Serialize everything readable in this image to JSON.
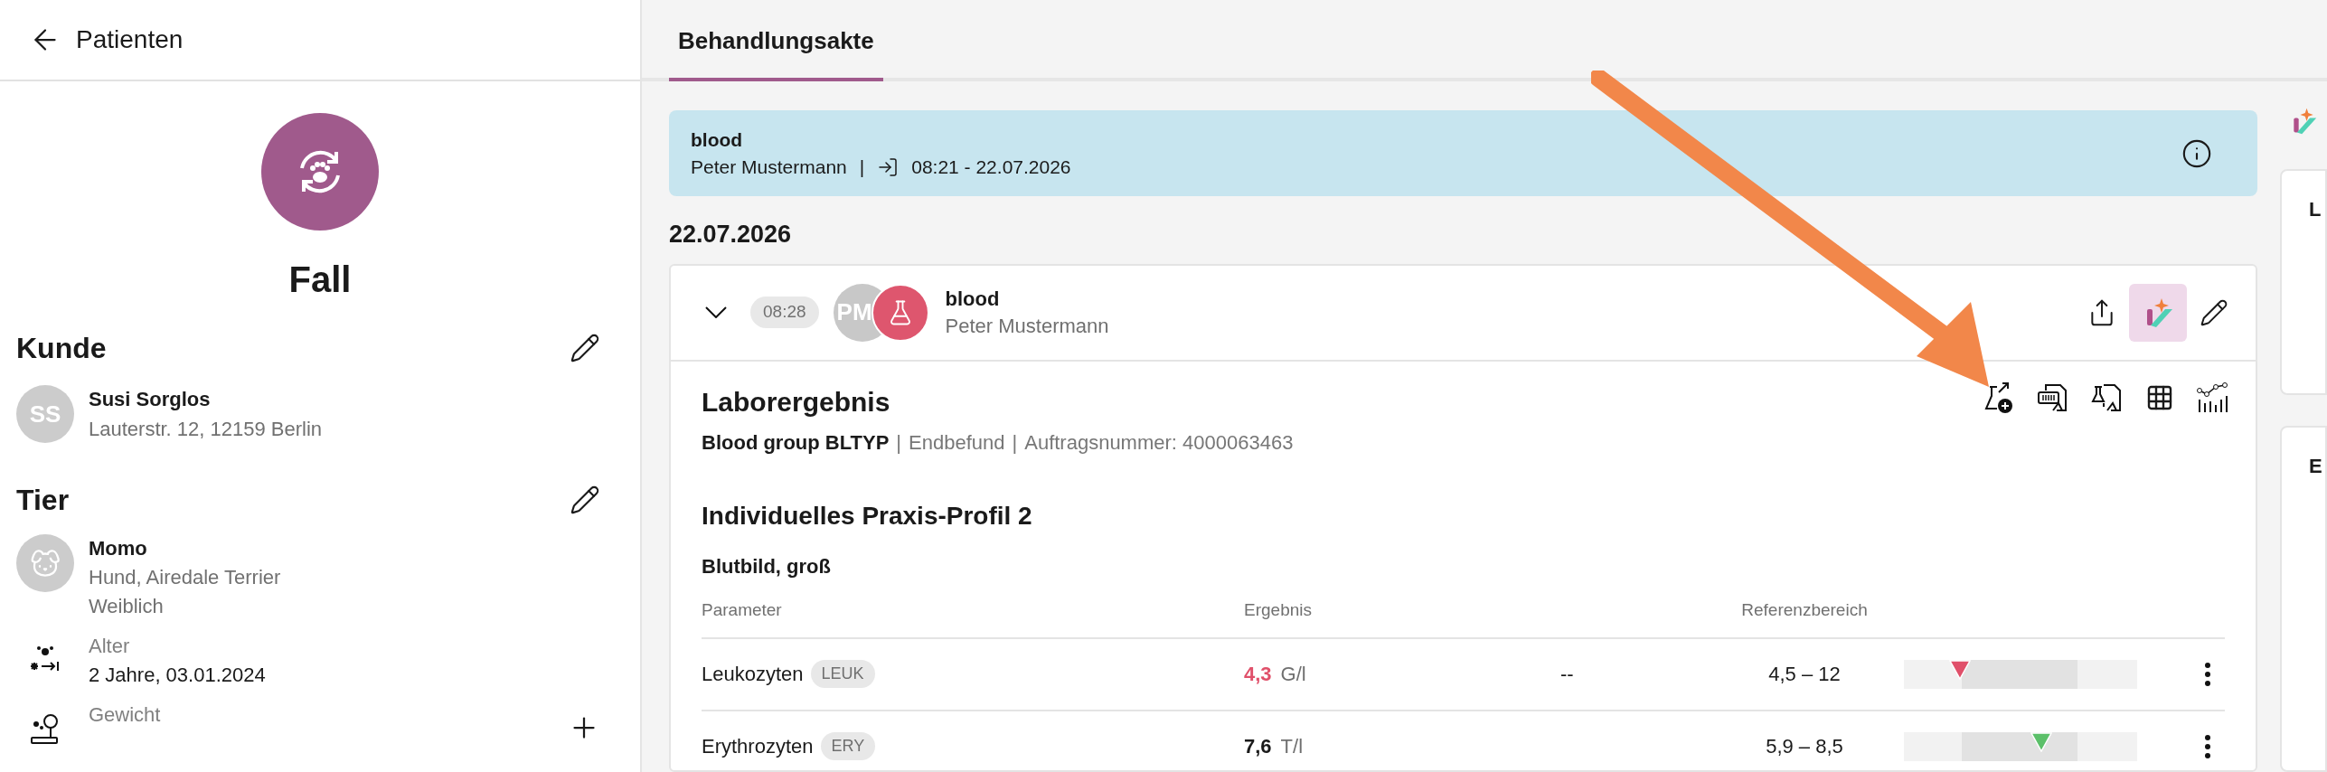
{
  "sidebar": {
    "back_label": "Patienten",
    "case_title": "Fall",
    "customer": {
      "heading": "Kunde",
      "initials": "SS",
      "name": "Susi Sorglos",
      "address": "Lauterstr. 12, 12159 Berlin"
    },
    "animal": {
      "heading": "Tier",
      "name": "Momo",
      "breed": "Hund, Airedale Terrier",
      "sex": "Weiblich"
    },
    "facts": [
      {
        "kind": "age",
        "label": "Alter",
        "value": "2 Jahre, 03.01.2024"
      },
      {
        "kind": "weight",
        "label": "Gewicht"
      }
    ]
  },
  "tabs": [
    {
      "label": "Behandlungsakte",
      "selected": true
    }
  ],
  "banner": {
    "title": "blood",
    "person": "Peter Mustermann",
    "separator": "|",
    "time": "08:21 - 22.07.2026"
  },
  "date_heading": "22.07.2026",
  "entry": {
    "expanded": true,
    "time": "08:28",
    "initials": "PM",
    "title": "blood",
    "person": "Peter Mustermann",
    "lab": {
      "title": "Laborergebnis",
      "test": "Blood group BLTYP",
      "status": "Endbefund",
      "order": "Auftragsnummer: 4000063463",
      "separator": "|",
      "profile": "Individuelles Praxis-Profil 2",
      "group": "Blutbild, groß",
      "columns": [
        "Parameter",
        "Ergebnis",
        "Referenzbereich"
      ],
      "rows": [
        {
          "name": "Leukozyten",
          "code": "LEUK",
          "value": "4,3",
          "unit": "G/l",
          "out_of_range": true,
          "color": "#e0506a",
          "previous": "--",
          "range": "4,5 – 12",
          "level": 0.24
        },
        {
          "name": "Erythrozyten",
          "code": "ERY",
          "value": "7,6",
          "unit": "T/l",
          "out_of_range": false,
          "color": "#5cc06a",
          "range": "5,9 – 8,5",
          "level": 0.59
        }
      ]
    }
  },
  "right_panel": {
    "cards": [
      "L",
      "E"
    ]
  }
}
